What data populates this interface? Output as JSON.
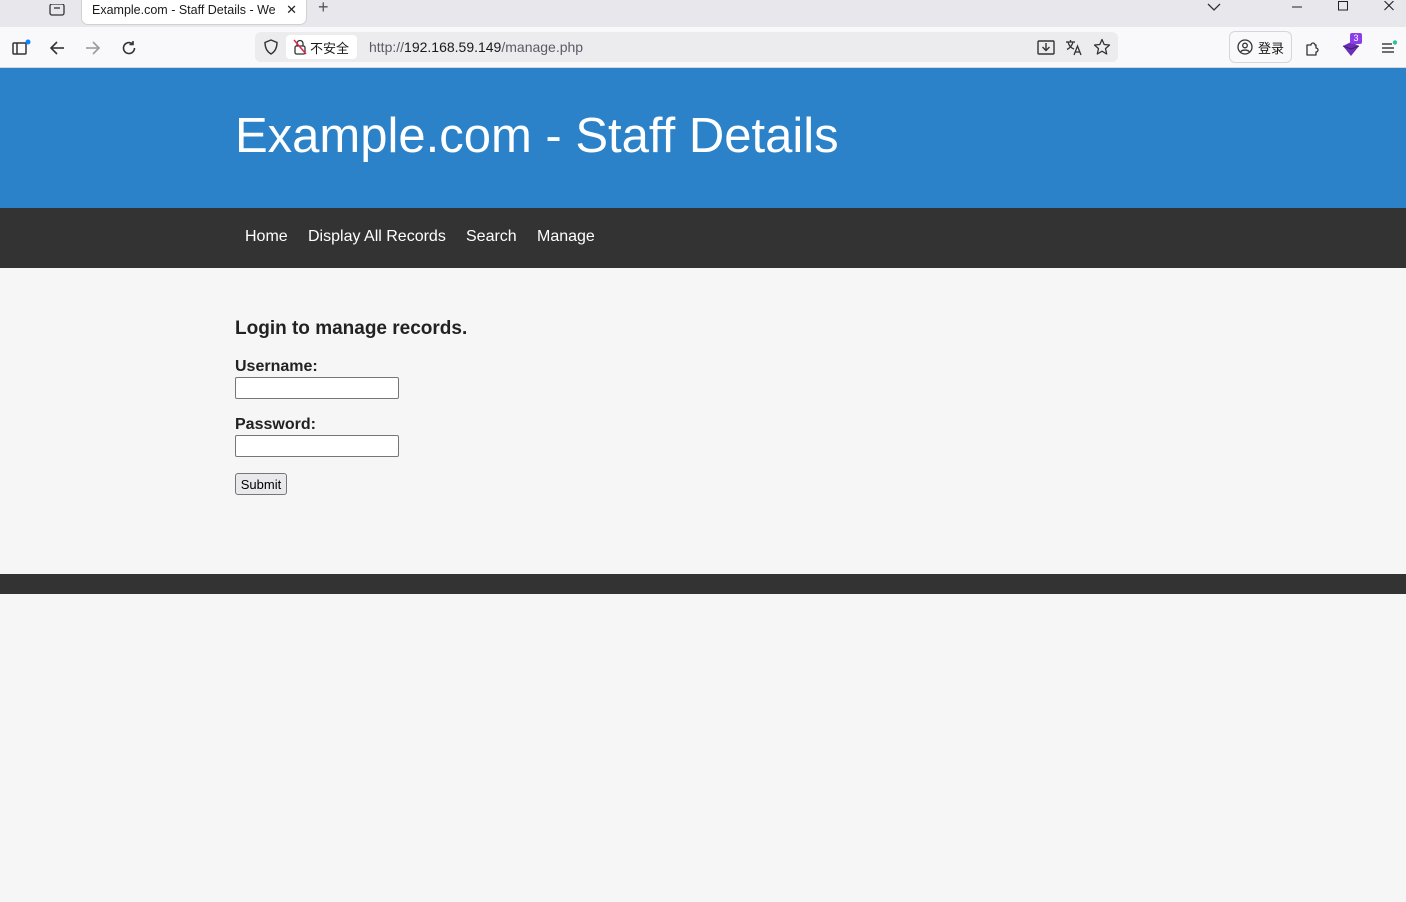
{
  "browser": {
    "tab_title": "Example.com - Staff Details - We",
    "tab_close": "✕",
    "new_tab": "+",
    "security_label": "不安全",
    "url_scheme": "http://",
    "url_host": "192.168.59.149",
    "url_path": "/manage.php",
    "login_label": "登录",
    "extension_badge": "3"
  },
  "site": {
    "title": "Example.com - Staff Details",
    "nav": [
      "Home",
      "Display All Records",
      "Search",
      "Manage"
    ]
  },
  "form": {
    "heading": "Login to manage records.",
    "username_label": "Username:",
    "username_value": "",
    "password_label": "Password:",
    "password_value": "",
    "submit_label": "Submit"
  },
  "colors": {
    "header_blue": "#2c82c9",
    "nav_dark": "#333333",
    "page_bg": "#f6f6f6"
  }
}
